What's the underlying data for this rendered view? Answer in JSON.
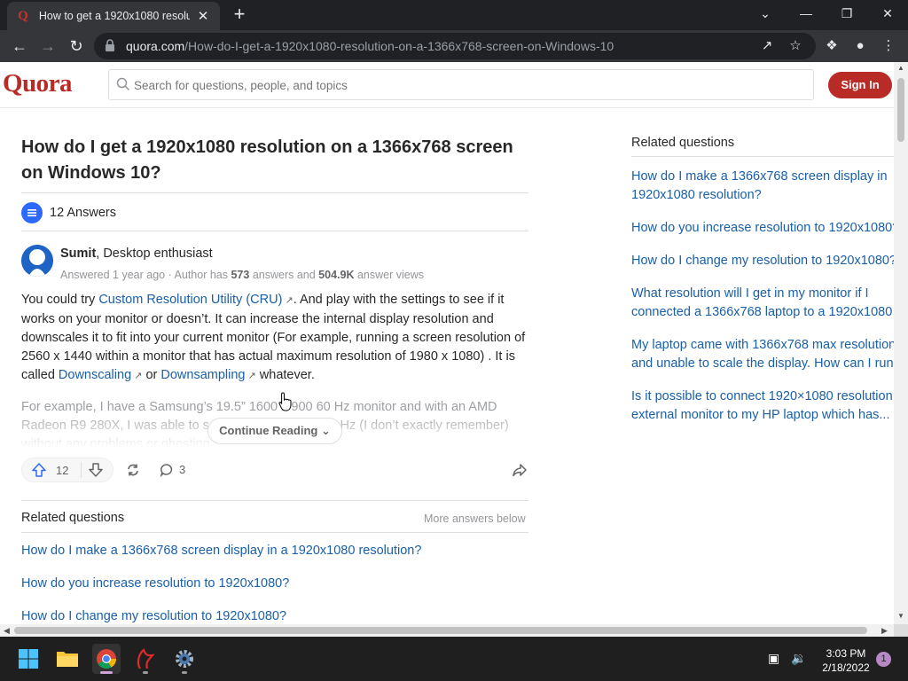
{
  "browser": {
    "tab_title": "How to get a 1920x1080 resolution on a 1366x768 screen on Windows 10",
    "tab_close": "✕",
    "new_tab": "+",
    "url_host": "quora.com",
    "url_path": "/How-do-I-get-a-1920x1080-resolution-on-a-1366x768-screen-on-Windows-10",
    "window_controls": {
      "chevron": "⌄",
      "minimize": "—",
      "restore": "❐",
      "close": "✕"
    }
  },
  "quora": {
    "logo": "Quora",
    "search_placeholder": "Search for questions, people, and topics",
    "sign_in": "Sign In"
  },
  "question": {
    "title": "How do I get a 1920x1080 resolution on a 1366x768 screen on Windows 10?",
    "answers_count": "12 Answers"
  },
  "answer": {
    "author_name": "Sumit",
    "author_cred": ", Desktop enthusiast",
    "meta_answered": "Answered 1 year ago · Author has ",
    "meta_answers": "573",
    "meta_mid": " answers and ",
    "meta_views": "504.9K",
    "meta_end": " answer views",
    "body_1": "You could try ",
    "link_cru": "Custom Resolution Utility (CRU)",
    "body_2": ". And play with the settings to see if it works on your monitor or doesn’t. It can increase the internal display resolution and downscales it to fit into your current monitor (For example, running a screen resolution of 2560 x 1440 within a monitor that has actual maximum resolution of 1980 x 1080) . It is called ",
    "link_downscaling": "Downscaling",
    "body_3": "or ",
    "link_downsampling": "Downsampling",
    "body_4": "whatever.",
    "faded_text": "For example, I have a Samsung’s 19.5” 1600 x 900 60 Hz monitor and with an AMD Radeon R9 280X, I was able to set it to 1920 x 1080 50 Hz (I don’t exactly remember) without any problems or ghosting.",
    "continue_reading": "Continue Reading",
    "upvotes": "12",
    "comments": "3"
  },
  "related_main": {
    "heading": "Related questions",
    "more": "More answers below",
    "items": [
      "How do I make a 1366x768 screen display in a 1920x1080 resolution?",
      "How do you increase resolution to 1920x1080?",
      "How do I change my resolution to 1920x1080?"
    ]
  },
  "related_side": {
    "heading": "Related questions",
    "items": [
      "How do I make a 1366x768 screen display in",
      "1920x1080 resolution?",
      "How do you increase resolution to 1920x1080?",
      "How do I change my resolution to 1920x1080?",
      "What resolution will I get in my monitor if I",
      "connected a 1366x768 laptop to a 1920x1080",
      "My laptop came with 1366x768 max resolution",
      "and unable to scale the display. How can I run",
      "Is it possible to connect 1920×1080 resolution",
      "external monitor to my HP laptop which has..."
    ]
  },
  "taskbar": {
    "time": "3:03 PM",
    "date": "2/18/2022",
    "notifications": "1"
  }
}
